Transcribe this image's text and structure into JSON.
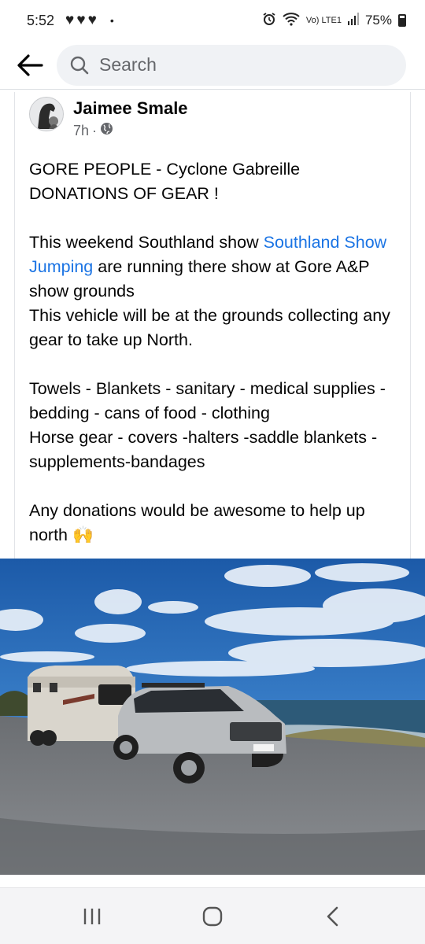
{
  "status_bar": {
    "time": "5:52",
    "hearts": "♥♥♥",
    "dot": "•",
    "network": "Vo) LTE1",
    "battery": "75%"
  },
  "search": {
    "placeholder": "Search"
  },
  "post": {
    "author": "Jaimee Smale",
    "time": "7h",
    "separator": "·",
    "body": {
      "para1": "GORE PEOPLE - Cyclone Gabreille DONATIONS OF GEAR !",
      "para2_before": "This weekend Southland show ",
      "para2_link": "Southland Show Jumping",
      "para2_after": " are running there show at Gore A&P show grounds",
      "para2_line2": "This vehicle will be at the grounds collecting any gear to take up North.",
      "para3_line1": "Towels - Blankets - sanitary - medical supplies - bedding - cans of food - clothing",
      "para3_line2": "Horse gear - covers -halters -saddle blankets - supplements-bandages",
      "para4": "Any donations would be awesome to help up north",
      "emoji": "🙌"
    }
  },
  "colors": {
    "link": "#1b74e4",
    "text": "#050505",
    "secondary": "#65676b"
  },
  "icons": {
    "back": "back-arrow-icon",
    "search": "search-icon",
    "globe": "globe-icon",
    "recents": "recent-apps-icon",
    "home": "home-icon",
    "nav_back": "back-chevron-icon"
  }
}
